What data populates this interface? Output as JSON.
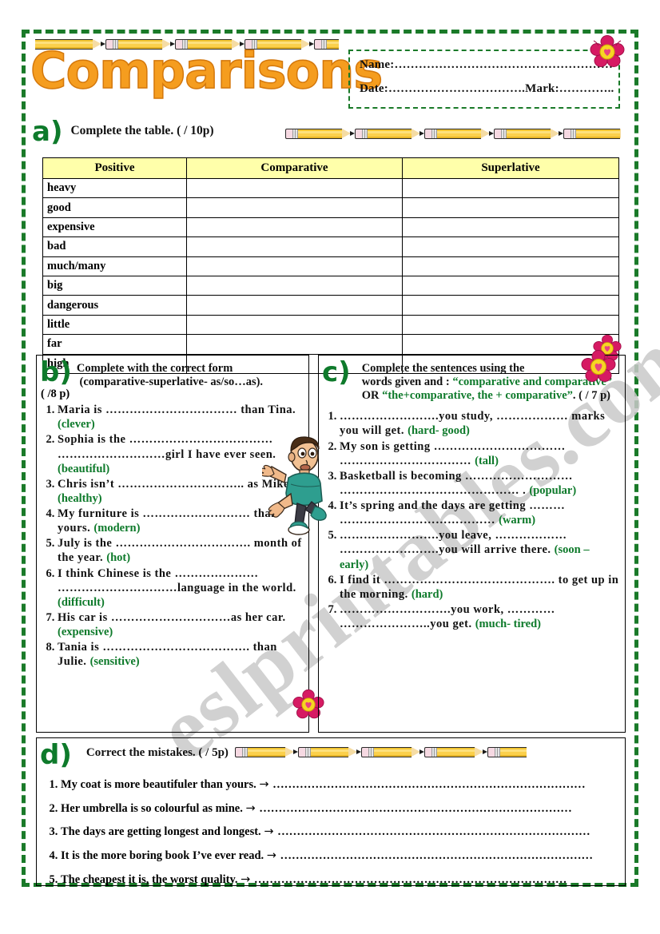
{
  "page": {
    "title": "Comparisons",
    "border_color": "#1a7a29",
    "title_color": "#f59d1f",
    "accent_green": "#0e7a2b",
    "table_header_bg": "#ffffaa",
    "watermark": "eslprintables.com"
  },
  "header": {
    "name_label": "Name:………………………………………………",
    "date_label": "Date:…………………………….Mark:………….."
  },
  "section_a": {
    "letter": "a)",
    "instruction": "Complete the table.  (        / 10p)",
    "columns": [
      "Positive",
      "Comparative",
      "Superlative"
    ],
    "rows": [
      "heavy",
      "good",
      "expensive",
      "bad",
      "much/many",
      "big",
      "dangerous",
      "little",
      "far",
      "high"
    ]
  },
  "section_b": {
    "letter": "b)",
    "instruction_line1": "Complete with the correct form",
    "instruction_line2": "(comparative-superlative- as/so…as).",
    "instruction_line3": "(        /8 p)",
    "items": [
      "Maria is …………………………… than Tina.(clever)",
      "Sophia is the ………………………………………………………girl I have ever seen. (beautiful)",
      "Chris isn’t ………………………….. as Mike. (healthy)",
      "My furniture is ……………………… than yours. (modern)",
      "July is the ……………………………. month of the year. (hot)",
      "I think Chinese is the ……………………………………………language in the world. (difficult)",
      "His car is …………………………as her car. (expensive)",
      "Tania is ………………………………. than Julie. (sensitive)"
    ],
    "items_plain": [
      {
        "text": "Maria is …………………………… than Tina.",
        "hint": "(clever)"
      },
      {
        "text": "Sophia is the ……………………………… ………………………girl I have ever seen.",
        "hint": "(beautiful)"
      },
      {
        "text": "Chris isn’t ………………………….. as Mike.",
        "hint": "(healthy)"
      },
      {
        "text": "My furniture is ……………………… than yours.",
        "hint": "(modern)"
      },
      {
        "text": "July is the ……………………………. month of the year.",
        "hint": "(hot)"
      },
      {
        "text": "I think Chinese is the ………………… …………………………language in the world.",
        "hint": "(difficult)"
      },
      {
        "text": "His car is …………………………as her car.",
        "hint": "(expensive)"
      },
      {
        "text": "Tania is ………………………………. than Julie.",
        "hint": "(sensitive)"
      }
    ]
  },
  "section_c": {
    "letter": "c)",
    "instruction_line1": "Complete the sentences using the",
    "instruction_line2": "words given and : ",
    "instruction_hl1": "“comparative and comparative”",
    "instruction_mid": " OR  ",
    "instruction_hl2": "“the+comparative, the + comparative”",
    "instruction_tail": ".   (        / 7 p)",
    "items_plain": [
      {
        "text": "…………………….you study, ……………… marks you will get.",
        "hint": "(hard- good)"
      },
      {
        "text": "My son is getting …………………………… ……………………………",
        "hint": "(tall)"
      },
      {
        "text": "Basketball  is becoming ……………………… ……………………………………… .",
        "hint": "(popular)"
      },
      {
        "text": "It’s spring and the days are getting ……… …………………………………",
        "hint": "(warm)"
      },
      {
        "text": "…………………….you leave, ……………… …………………….you will arrive there.",
        "hint": "(soon – early)"
      },
      {
        "text": "I find it ……………………………………. to get up in the morning.",
        "hint": "(hard)"
      },
      {
        "text": "……………………….you work, ………… …………………..you get.",
        "hint": "(much- tired)"
      }
    ]
  },
  "section_d": {
    "letter": "d)",
    "instruction": "Correct the mistakes.   (       / 5p)",
    "arrow": "→",
    "answer_dots": "………………………………………………………………………",
    "items": [
      "My coat is more beautifuler than yours.",
      "Her umbrella is so colourful as mine.",
      "The days are getting longest and  longest.",
      "It is the more boring book I’ve ever read.",
      "The cheapest it is, the worst quality."
    ]
  },
  "decorations": {
    "pencil_icon": "pencil-icon",
    "flower_icon": "flower-icon",
    "boy_icon": "cartoon-boy-icon"
  }
}
